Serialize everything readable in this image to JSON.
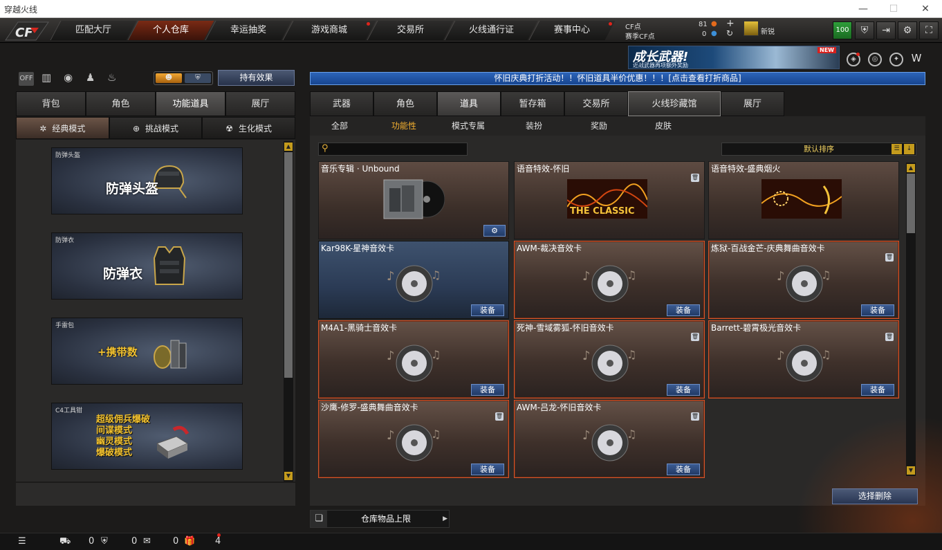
{
  "window": {
    "title": "穿越火线",
    "min": "—",
    "max": "☐",
    "close": "✕"
  },
  "nav": {
    "tabs": [
      "匹配大厅",
      "个人仓库",
      "幸运抽奖",
      "游戏商城",
      "交易所",
      "火线通行证",
      "赛事中心"
    ],
    "cf_label": "CF点",
    "cf_value": "81",
    "match_label": "赛季CF点",
    "match_value": "0",
    "rank_label": "新锐",
    "level": "100"
  },
  "banner": {
    "title": "成长武器!",
    "subtitle": "近战武器再项额外奖励",
    "badge": "NEW"
  },
  "left": {
    "effect_button": "持有效果",
    "tabs": [
      "背包",
      "角色",
      "功能道具",
      "展厅"
    ],
    "modes": [
      "经典模式",
      "挑战模式",
      "生化模式"
    ],
    "cards": [
      {
        "title": "防弹头盔",
        "big": "防弹头盔"
      },
      {
        "title": "防弹衣",
        "big": "防弹衣"
      },
      {
        "title": "手雷包",
        "big": "+携带数"
      },
      {
        "title": "C4工具钳",
        "lines": [
          "超级佣兵爆破",
          "间谍模式",
          "幽灵模式",
          "爆破模式"
        ]
      }
    ]
  },
  "right": {
    "notice": "怀旧庆典打折活动！！怀旧道具半价优惠！！！[点击查看打折商品]",
    "tabs": [
      "武器",
      "角色",
      "道具",
      "暂存箱",
      "交易所",
      "火线珍藏馆",
      "展厅"
    ],
    "subtabs": [
      "全部",
      "功能性",
      "模式专属",
      "装扮",
      "奖励",
      "皮肤"
    ],
    "sort": "默认排序",
    "items": [
      "音乐专辑 · Unbound",
      "语音特效-怀旧",
      "语音特效-盛典烟火",
      "Kar98K-星神音效卡",
      "AWM-裁决音效卡",
      "炼狱-百战金芒-庆典舞曲音效卡",
      "M4A1-黑骑士音效卡",
      "死神-雪域雾狐-怀旧音效卡",
      "Barrett-碧霄极光音效卡",
      "沙鹰-修罗-盛典舞曲音效卡",
      "AWM-吕龙-怀旧音效卡"
    ],
    "classic_label": "THE CLASSIC",
    "equip": "装备",
    "delete_button": "选择删除",
    "capacity": "仓库物品上限"
  },
  "status": {
    "count1": "0",
    "count2": "0",
    "count3": "0",
    "count4": "4"
  }
}
